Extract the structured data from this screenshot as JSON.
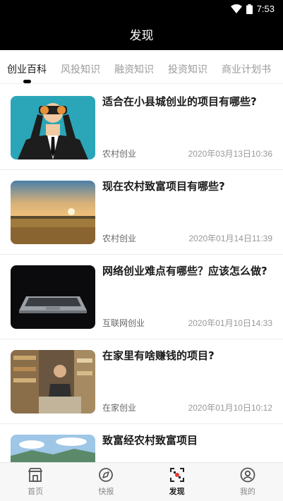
{
  "status_bar": {
    "time": "7:53",
    "icons": [
      "wifi-icon",
      "battery-icon"
    ]
  },
  "header": {
    "title": "发现"
  },
  "tabs": [
    {
      "label": "创业百科",
      "active": true
    },
    {
      "label": "风投知识",
      "active": false
    },
    {
      "label": "融资知识",
      "active": false
    },
    {
      "label": "投资知识",
      "active": false
    },
    {
      "label": "商业计划书",
      "active": false
    }
  ],
  "articles": [
    {
      "title": "适合在小县城创业的项目有哪些?",
      "category": "农村创业",
      "date": "2020年03月13日10:36",
      "thumb": "businessman-binoculars"
    },
    {
      "title": "现在农村致富项目有哪些?",
      "category": "农村创业",
      "date": "2020年01月14日11:39",
      "thumb": "sunset-field"
    },
    {
      "title": "网络创业难点有哪些？应该怎么做?",
      "category": "互联网创业",
      "date": "2020年01月10日14:33",
      "thumb": "laptop-dark"
    },
    {
      "title": "在家里有啥赚钱的项目?",
      "category": "在家创业",
      "date": "2020年01月10日10:12",
      "thumb": "bookstore-man"
    },
    {
      "title": "致富经农村致富项目",
      "category": "",
      "date": "",
      "thumb": "mountain-sky"
    }
  ],
  "bottom_nav": [
    {
      "label": "首页",
      "icon": "home-store-icon",
      "active": false
    },
    {
      "label": "快报",
      "icon": "news-compass-icon",
      "active": false
    },
    {
      "label": "发现",
      "icon": "discover-scan-icon",
      "active": true
    },
    {
      "label": "我的",
      "icon": "profile-icon",
      "active": false
    }
  ],
  "colors": {
    "header_bg": "#000000",
    "accent_red": "#e53935",
    "active_text": "#1a1a1a",
    "inactive_text": "#9a9a9a"
  }
}
